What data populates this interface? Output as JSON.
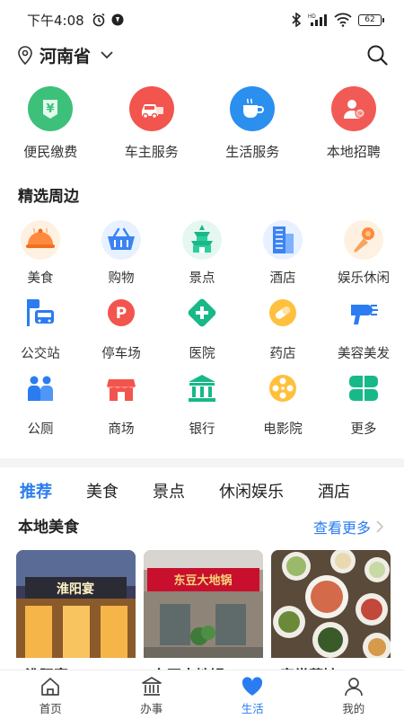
{
  "status_bar": {
    "time": "下午4:08",
    "battery": "62"
  },
  "header": {
    "province": "河南省"
  },
  "top_services": [
    {
      "label": "便民缴费",
      "color": "#3cc07a",
      "icon": "yen-bill-icon"
    },
    {
      "label": "车主服务",
      "color": "#f2554d",
      "icon": "car-icon"
    },
    {
      "label": "生活服务",
      "color": "#2b8ff0",
      "icon": "coffee-cup-icon"
    },
    {
      "label": "本地招聘",
      "color": "#f25a55",
      "icon": "recruit-person-icon"
    }
  ],
  "nearby": {
    "title": "精选周边",
    "row1": [
      {
        "label": "美食",
        "icon": "food-dish-icon"
      },
      {
        "label": "购物",
        "icon": "shopping-basket-icon"
      },
      {
        "label": "景点",
        "icon": "landmark-tower-icon"
      },
      {
        "label": "酒店",
        "icon": "hotel-building-icon"
      },
      {
        "label": "娱乐休闲",
        "icon": "microphone-icon"
      }
    ],
    "row2": [
      {
        "label": "公交站",
        "icon": "bus-stop-icon"
      },
      {
        "label": "停车场",
        "icon": "parking-icon"
      },
      {
        "label": "医院",
        "icon": "hospital-cross-icon"
      },
      {
        "label": "药店",
        "icon": "pill-icon"
      },
      {
        "label": "美容美发",
        "icon": "hair-dryer-icon"
      }
    ],
    "row3": [
      {
        "label": "公厕",
        "icon": "restroom-icon"
      },
      {
        "label": "商场",
        "icon": "mall-storefront-icon"
      },
      {
        "label": "银行",
        "icon": "bank-icon"
      },
      {
        "label": "电影院",
        "icon": "film-reel-icon"
      },
      {
        "label": "更多",
        "icon": "more-clover-icon"
      }
    ]
  },
  "category_tabs": [
    "推荐",
    "美食",
    "景点",
    "休闲娱乐",
    "酒店"
  ],
  "local_food": {
    "title": "本地美食",
    "more_label": "查看更多",
    "cards": [
      {
        "name": "淮阳宴",
        "sign": "淮阳宴"
      },
      {
        "name": "东豆大地锅",
        "sign": "东豆大地锅"
      },
      {
        "name": "家常菜馆",
        "sign": ""
      }
    ]
  },
  "bottom_nav": [
    {
      "label": "首页",
      "icon": "home-icon"
    },
    {
      "label": "办事",
      "icon": "government-building-icon"
    },
    {
      "label": "生活",
      "icon": "heart-icon",
      "active": true
    },
    {
      "label": "我的",
      "icon": "user-icon"
    }
  ],
  "colors": {
    "accent": "#2a7cf0"
  }
}
